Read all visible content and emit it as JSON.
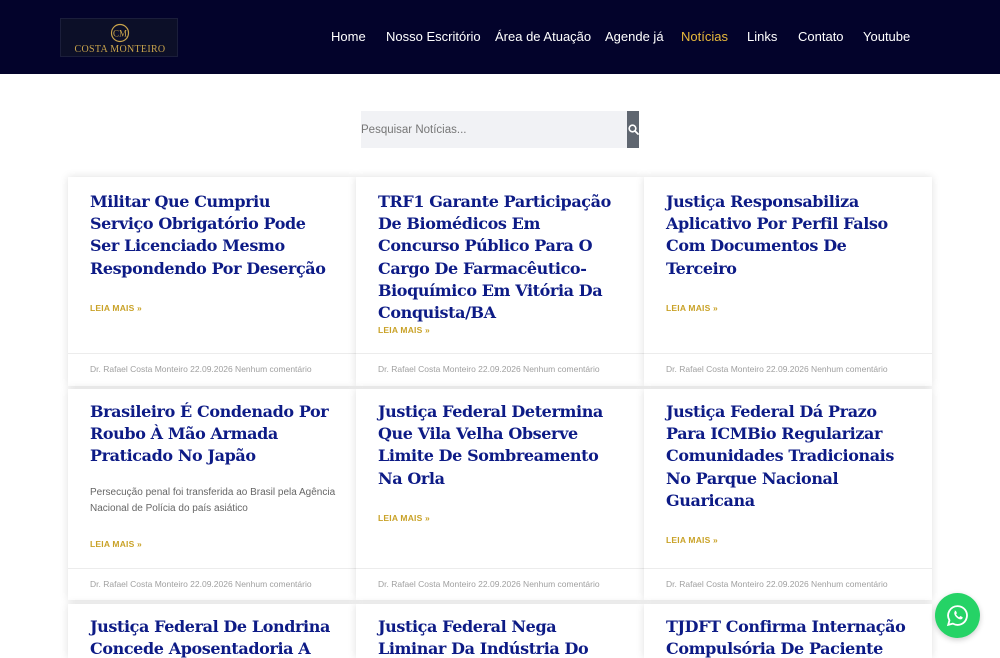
{
  "brand": {
    "name": "COSTA MONTEIRO",
    "accent": "#e8b93b",
    "header_bg": "#03032b",
    "title_color": "#0d1b86"
  },
  "nav": [
    {
      "label": "Home",
      "active": false
    },
    {
      "label": "Nosso Escritório",
      "active": false
    },
    {
      "label": "Área de Atuação",
      "active": false
    },
    {
      "label": "Agende já",
      "active": false
    },
    {
      "label": "Notícias",
      "active": true
    },
    {
      "label": "Links",
      "active": false
    },
    {
      "label": "Contato",
      "active": false
    },
    {
      "label": "Youtube",
      "active": false
    }
  ],
  "search": {
    "placeholder": "Pesquisar Notícias...",
    "value": "",
    "icon": "search-icon"
  },
  "read_more_label": "LEIA MAIS »",
  "posts": [
    {
      "title": "Militar Que Cumpriu Serviço Obrigatório Pode Ser Licenciado Mesmo Respondendo Por Deserção",
      "excerpt": "",
      "meta": "Dr. Rafael Costa Monteiro 22.09.2026 Nenhum comentário"
    },
    {
      "title": "TRF1 Garante Participação De Biomédicos Em Concurso Público Para O Cargo De Farmacêutico-Bioquímico Em Vitória Da Conquista/BA",
      "excerpt": "",
      "meta": "Dr. Rafael Costa Monteiro 22.09.2026 Nenhum comentário"
    },
    {
      "title": "Justiça Responsabiliza Aplicativo Por Perfil Falso Com Documentos De Terceiro",
      "excerpt": "",
      "meta": "Dr. Rafael Costa Monteiro 22.09.2026 Nenhum comentário"
    },
    {
      "title": "Brasileiro É Condenado Por Roubo À Mão Armada Praticado No Japão",
      "excerpt": "Persecução penal foi transferida ao Brasil pela Agência Nacional de Polícia do país asiático",
      "meta": "Dr. Rafael Costa Monteiro 22.09.2026 Nenhum comentário"
    },
    {
      "title": "Justiça Federal Determina Que Vila Velha Observe Limite De Sombreamento Na Orla",
      "excerpt": "",
      "meta": "Dr. Rafael Costa Monteiro 22.09.2026 Nenhum comentário"
    },
    {
      "title": "Justiça Federal Dá Prazo Para ICMBio Regularizar Comunidades Tradicionais No Parque Nacional Guaricana",
      "excerpt": "",
      "meta": "Dr. Rafael Costa Monteiro 22.09.2026 Nenhum comentário"
    },
    {
      "title": "Justiça Federal De Londrina Concede Aposentadoria A",
      "excerpt": "",
      "meta": ""
    },
    {
      "title": "Justiça Federal Nega Liminar Da Indústria Do Paraná Pela",
      "excerpt": "",
      "meta": ""
    },
    {
      "title": "TJDFT Confirma Internação Compulsória De Paciente",
      "excerpt": "",
      "meta": ""
    }
  ],
  "whatsapp": {
    "icon": "whatsapp-icon",
    "color": "#25d366"
  }
}
